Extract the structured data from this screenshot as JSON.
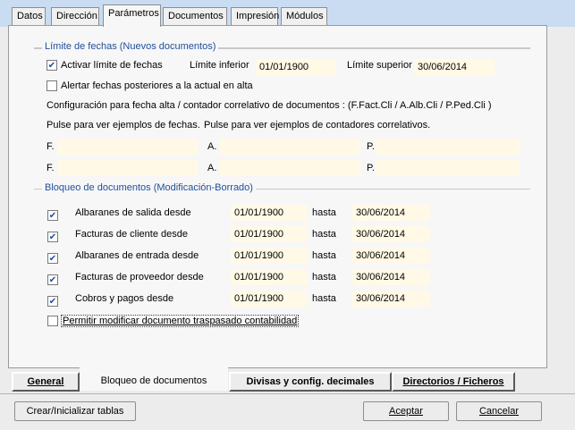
{
  "top_tabs": [
    {
      "label": "Datos",
      "active": false
    },
    {
      "label": "Dirección",
      "active": false
    },
    {
      "label": "Parámetros",
      "active": true
    },
    {
      "label": "Documentos",
      "active": false
    },
    {
      "label": "Impresión",
      "active": false
    },
    {
      "label": "Módulos",
      "active": false
    }
  ],
  "fechas_group": {
    "legend": "Límite de fechas (Nuevos documentos)",
    "activar_label": "Activar límite de fechas",
    "activar_checked": true,
    "limite_inferior_label": "Límite inferior",
    "limite_inferior_value": "01/01/1900",
    "limite_superior_label": "Límite superior",
    "limite_superior_value": "30/06/2014",
    "alertar_label": "Alertar fechas posteriores a la actual en alta",
    "alertar_checked": false,
    "config_text": "Configuración para fecha alta / contador correlativo de documentos : (F.Fact.Cli / A.Alb.Cli / P.Ped.Cli )",
    "pulse_fechas": "Pulse para ver ejemplos de fechas.",
    "pulse_contadores": "Pulse para ver ejemplos de contadores correlativos.",
    "row_labels": [
      "F.",
      "A.",
      "P."
    ],
    "rows": [
      [
        "",
        "",
        ""
      ],
      [
        "",
        "",
        ""
      ]
    ]
  },
  "bloqueo_group": {
    "legend": "Bloqueo de documentos  (Modificación-Borrado)",
    "hasta_label": "hasta",
    "rows": [
      {
        "label": "Albaranes de salida desde",
        "checked": true,
        "from": "01/01/1900",
        "to": "30/06/2014"
      },
      {
        "label": "Facturas de cliente desde",
        "checked": true,
        "from": "01/01/1900",
        "to": "30/06/2014"
      },
      {
        "label": "Albaranes de entrada desde",
        "checked": true,
        "from": "01/01/1900",
        "to": "30/06/2014"
      },
      {
        "label": "Facturas de proveedor desde",
        "checked": true,
        "from": "01/01/1900",
        "to": "30/06/2014"
      },
      {
        "label": "Cobros y pagos desde",
        "checked": true,
        "from": "01/01/1900",
        "to": "30/06/2014"
      }
    ],
    "permitir_label": "Permitir modificar documento traspasado contabilidad",
    "permitir_checked": false
  },
  "bottom_tabs": [
    {
      "label": "General",
      "active": false
    },
    {
      "label": "Bloqueo de documentos",
      "active": true
    },
    {
      "label": "Divisas y config. decimales",
      "active": false
    },
    {
      "label": "Directorios / Ficheros",
      "active": false
    }
  ],
  "buttons": {
    "crear": "Crear/Inicializar tablas",
    "aceptar": "Aceptar",
    "cancelar": "Cancelar"
  }
}
